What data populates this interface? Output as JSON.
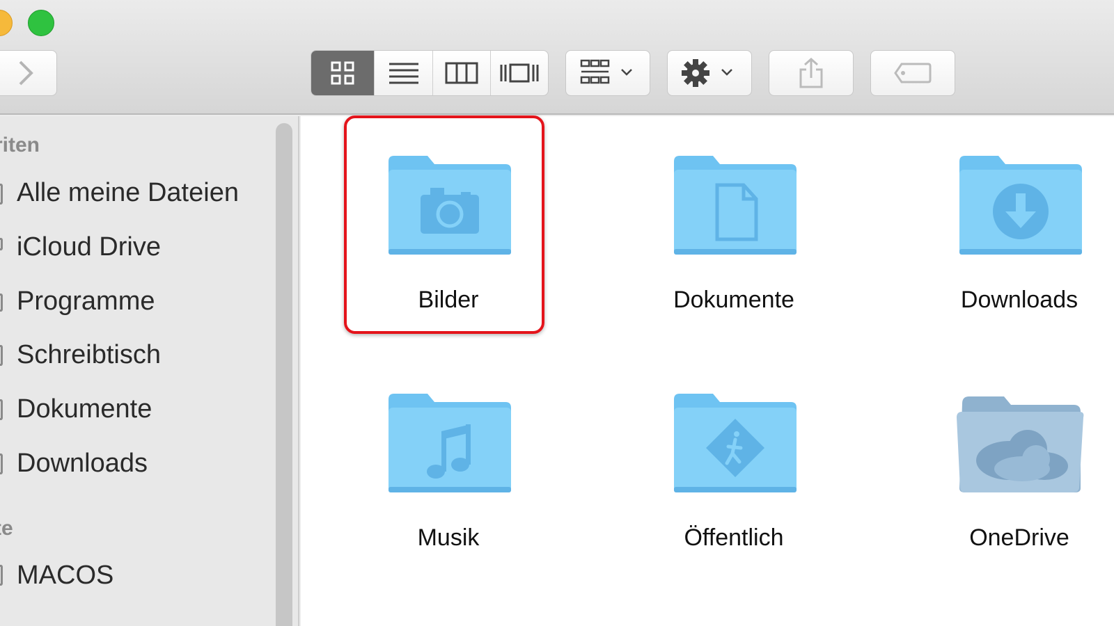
{
  "window": {
    "controls": [
      "minimize-button",
      "zoom-button"
    ]
  },
  "toolbar": {
    "forward_icon": "chevron-right-icon",
    "views": [
      "icon-view-icon",
      "list-view-icon",
      "column-view-icon",
      "cover-flow-icon"
    ],
    "active_view": "icon-view",
    "arrange_icon": "arrange-grid-icon",
    "action_icon": "gear-icon",
    "share_icon": "share-icon",
    "tag_icon": "tag-icon"
  },
  "sidebar": {
    "favorites_heading": "riten",
    "favorites": [
      {
        "label": "Alle meine Dateien"
      },
      {
        "label": "iCloud Drive"
      },
      {
        "label": "Programme"
      },
      {
        "label": "Schreibtisch"
      },
      {
        "label": "Dokumente"
      },
      {
        "label": "Downloads"
      }
    ],
    "devices_heading": "te",
    "devices": [
      {
        "label": "MACOS"
      }
    ]
  },
  "content": {
    "items": [
      {
        "label": "Bilder",
        "icon": "camera-folder-icon",
        "selected": true
      },
      {
        "label": "Dokumente",
        "icon": "document-folder-icon"
      },
      {
        "label": "Downloads",
        "icon": "download-folder-icon"
      },
      {
        "label": "Musik",
        "icon": "music-folder-icon"
      },
      {
        "label": "Öffentlich",
        "icon": "public-folder-icon"
      },
      {
        "label": "OneDrive",
        "icon": "onedrive-cloud-folder-icon"
      }
    ]
  },
  "colors": {
    "folder": "#7ccdf7",
    "folder_dark": "#5fb3e6",
    "selection_outline": "#e4141b",
    "close_yellow": "#f6b93b",
    "zoom_green": "#2fc240"
  }
}
